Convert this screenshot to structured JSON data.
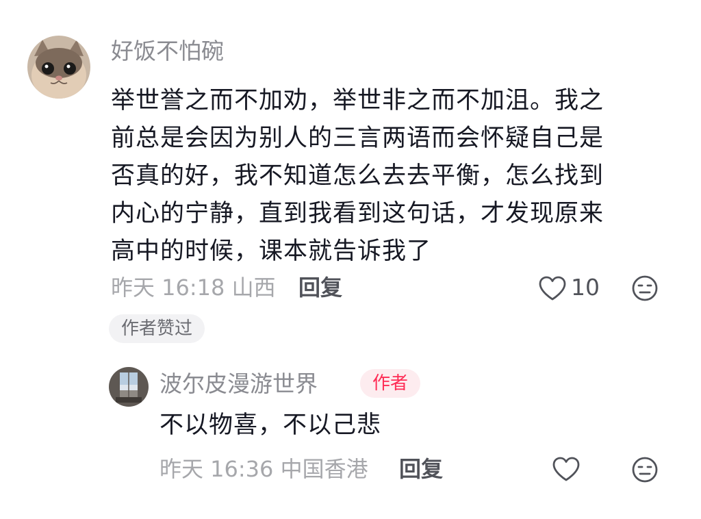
{
  "comment": {
    "username": "好饭不怕碗",
    "text_lines": [
      "举世誉之而不加劝，举世非之而不加沮。我之",
      "前总是会因为别人的三言两语而会怀疑自己是",
      "否真的好，我不知道怎么去去平衡，怎么找到",
      "内心的宁静，直到我看到这句话，才发现原来",
      "高中的时候，课本就告诉我了"
    ],
    "meta": "昨天 16:18 山西",
    "reply_label": "回复",
    "like_count": "10",
    "author_liked_tag": "作者赞过",
    "icons": {
      "like": "heart-outline-icon",
      "dislike": "frown-face-icon"
    }
  },
  "reply": {
    "username": "波尔皮漫游世界",
    "badge": "作者",
    "text": "不以物喜，不以己悲",
    "meta": "昨天 16:36 中国香港",
    "reply_label": "回复",
    "icons": {
      "like": "heart-outline-icon",
      "dislike": "frown-face-icon"
    }
  },
  "colors": {
    "text_primary": "#161823",
    "text_secondary": "#8a8b91",
    "meta": "#a6a7ab",
    "author_badge_text": "#fe2c55",
    "author_badge_bg": "#fdecef",
    "tag_bg": "#f2f2f4"
  }
}
